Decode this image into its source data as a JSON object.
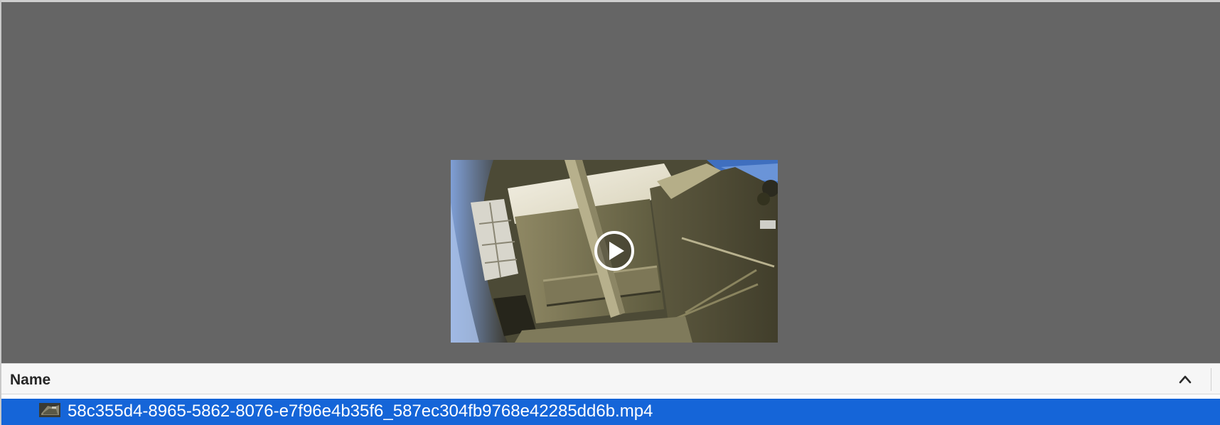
{
  "preview": {
    "media_type": "video",
    "play_icon": "play-icon"
  },
  "list": {
    "column_header": "Name",
    "sort_icon": "chevron-up-icon",
    "rows": [
      {
        "name": "58c355d4-8965-5862-8076-e7f96e4b35f6_587ec304fb9768e42285dd6b.mp4",
        "icon": "video-file-icon",
        "selected": true
      }
    ]
  },
  "colors": {
    "preview_background": "#656565",
    "selection": "#1565d8",
    "header_background": "#f6f6f6"
  }
}
